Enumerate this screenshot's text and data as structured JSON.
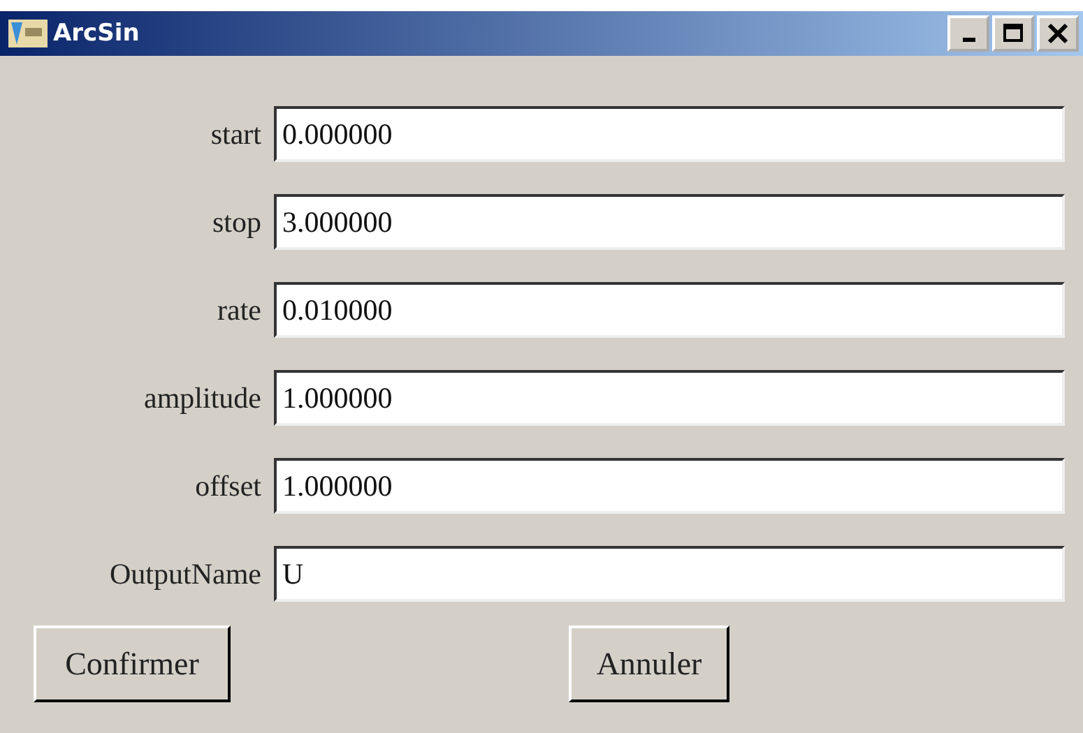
{
  "window": {
    "title": "ArcSin"
  },
  "fields": [
    {
      "label": "start",
      "value": "0.000000"
    },
    {
      "label": "stop",
      "value": "3.000000"
    },
    {
      "label": "rate",
      "value": "0.010000"
    },
    {
      "label": "amplitude",
      "value": "1.000000"
    },
    {
      "label": "offset",
      "value": "1.000000"
    },
    {
      "label": "OutputName",
      "value": "U"
    }
  ],
  "buttons": [
    "Confirmer",
    "Annuler"
  ]
}
